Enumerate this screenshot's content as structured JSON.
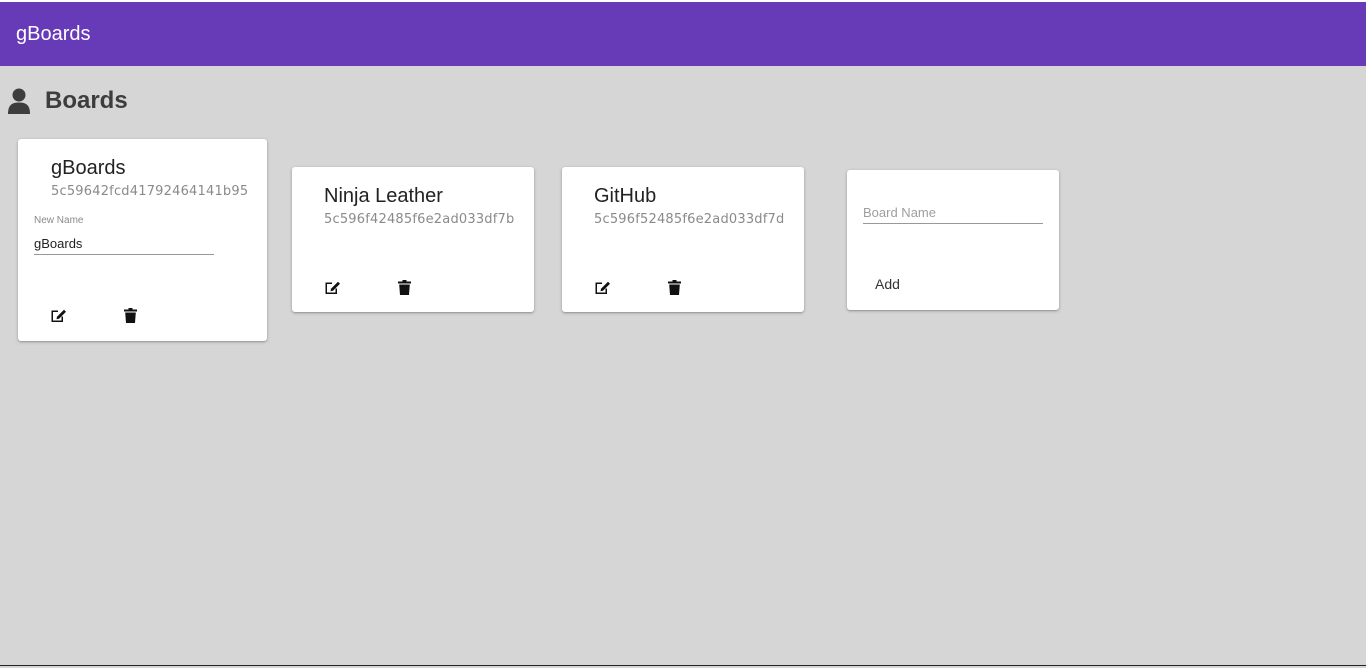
{
  "app": {
    "title": "gBoards",
    "accent_color": "#673ab7",
    "background_color": "#d6d6d6"
  },
  "header": {
    "title": "Boards",
    "icon": "user-icon"
  },
  "boards": [
    {
      "name": "gBoards",
      "id": "5c59642fcd41792464141b95",
      "editing": true,
      "edit_field_label": "New Name",
      "edit_field_value": "gBoards",
      "edit_icon": "edit-icon",
      "delete_icon": "trash-icon"
    },
    {
      "name": "Ninja Leather",
      "id": "5c596f42485f6e2ad033df7b",
      "editing": false,
      "edit_icon": "edit-icon",
      "delete_icon": "trash-icon"
    },
    {
      "name": "GitHub",
      "id": "5c596f52485f6e2ad033df7d",
      "editing": false,
      "edit_icon": "edit-icon",
      "delete_icon": "trash-icon"
    }
  ],
  "new_board": {
    "placeholder": "Board Name",
    "value": "",
    "add_label": "Add"
  }
}
